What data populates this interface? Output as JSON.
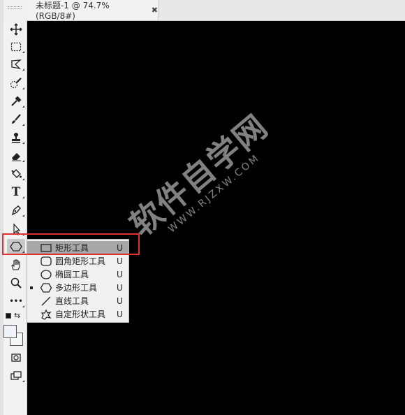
{
  "document_tab": {
    "title": "未标题-1 @ 74.7%(RGB/8#)",
    "close_glyph": "✖"
  },
  "toolbar": {
    "tools": [
      {
        "name": "move-tool",
        "icon": "move-icon"
      },
      {
        "name": "marquee-tool",
        "icon": "rect-marquee-icon"
      },
      {
        "name": "lasso-tool",
        "icon": "lasso-icon"
      },
      {
        "name": "quick-select-tool",
        "icon": "quick-select-icon"
      },
      {
        "name": "eyedropper-tool",
        "icon": "eyedropper-icon"
      },
      {
        "name": "brush-tool",
        "icon": "brush-icon"
      },
      {
        "name": "stamp-tool",
        "icon": "stamp-icon"
      },
      {
        "name": "eraser-tool",
        "icon": "eraser-icon"
      },
      {
        "name": "paint-bucket-tool",
        "icon": "paint-bucket-icon"
      },
      {
        "name": "type-tool",
        "icon": "type-icon",
        "label": "T"
      },
      {
        "name": "pen-tool",
        "icon": "pen-icon"
      },
      {
        "name": "path-select-tool",
        "icon": "arrow-icon"
      },
      {
        "name": "shape-tool",
        "icon": "hexagon-icon"
      },
      {
        "name": "hand-tool",
        "icon": "hand-icon"
      },
      {
        "name": "zoom-tool",
        "icon": "magnifier-icon"
      },
      {
        "name": "more-tools",
        "icon": "ellipsis-icon",
        "label": "•••"
      }
    ]
  },
  "shape_flyout": {
    "items": [
      {
        "label": "矩形工具",
        "key": "U",
        "icon": "rectangle-icon",
        "selected": true,
        "current": false
      },
      {
        "label": "圆角矩形工具",
        "key": "U",
        "icon": "rounded-rectangle-icon",
        "selected": false,
        "current": false
      },
      {
        "label": "椭圆工具",
        "key": "U",
        "icon": "ellipse-icon",
        "selected": false,
        "current": false
      },
      {
        "label": "多边形工具",
        "key": "U",
        "icon": "polygon-icon",
        "selected": false,
        "current": true
      },
      {
        "label": "直线工具",
        "key": "U",
        "icon": "line-icon",
        "selected": false,
        "current": false
      },
      {
        "label": "自定形状工具",
        "key": "U",
        "icon": "custom-shape-icon",
        "selected": false,
        "current": false
      }
    ]
  },
  "watermark": {
    "main": "软件自学网",
    "sub": "WWW.RJZXW.COM"
  },
  "colors": {
    "canvas": "#000000",
    "highlight": "#e03030",
    "selected_row": "#a7a7a7"
  }
}
